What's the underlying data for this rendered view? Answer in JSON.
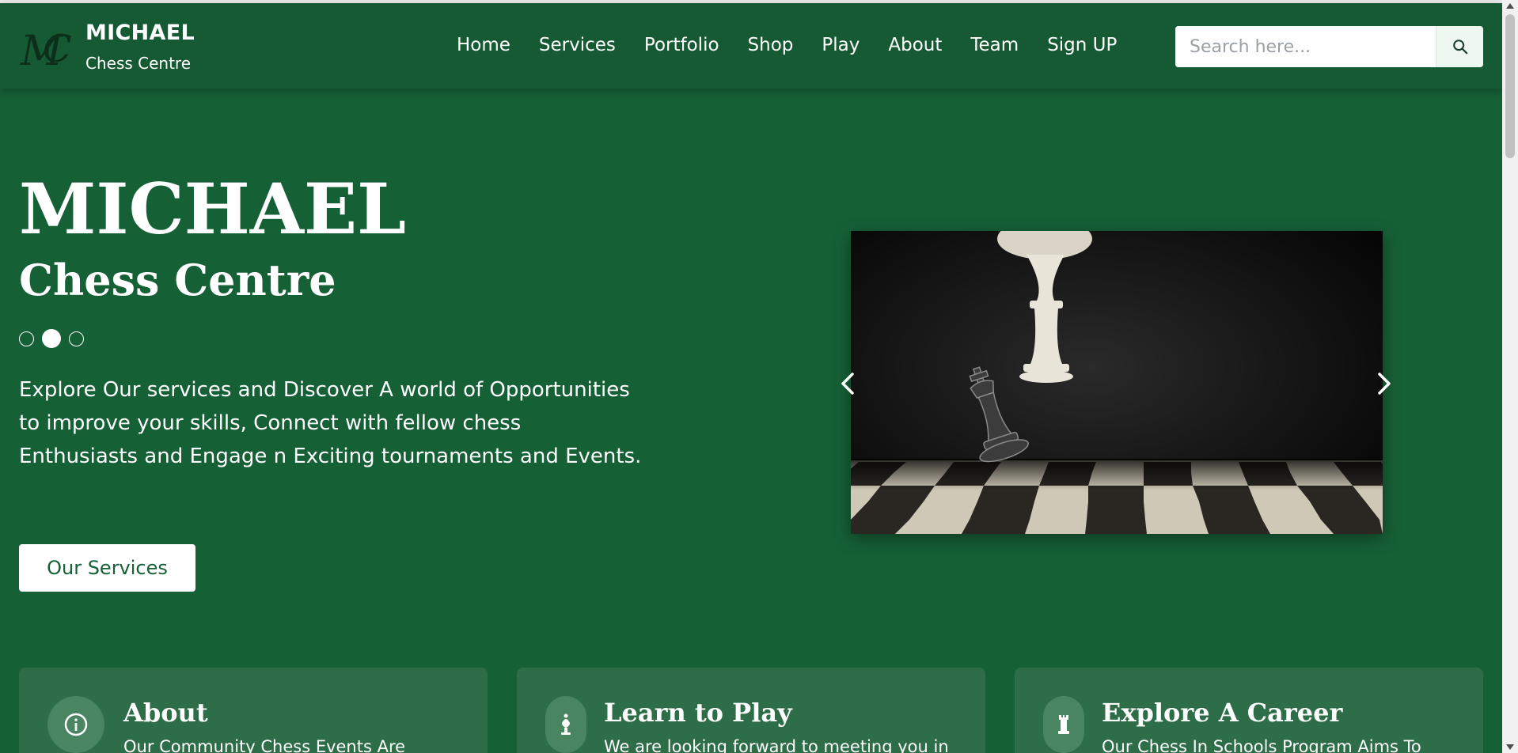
{
  "header": {
    "brand_name": "MICHAEL",
    "brand_sub": "Chess Centre",
    "logo_text": "MC",
    "nav": [
      {
        "label": "Home"
      },
      {
        "label": "Services"
      },
      {
        "label": "Portfolio"
      },
      {
        "label": "Shop"
      },
      {
        "label": "Play"
      },
      {
        "label": "About"
      },
      {
        "label": "Team"
      },
      {
        "label": "Sign UP"
      }
    ],
    "search_placeholder": "Search here..."
  },
  "hero": {
    "title": "MICHAEL",
    "subtitle": "Chess Centre",
    "slides_count": 3,
    "active_slide": 2,
    "description": "Explore Our services and Discover A world of Opportunities to improve your skills, Connect with fellow chess Enthusiasts and Engage n Exciting tournaments and Events.",
    "button_label": "Our Services"
  },
  "cards": [
    {
      "title": "About",
      "text": "Our Community Chess Events Are",
      "icon": "info-icon"
    },
    {
      "title": "Learn to Play",
      "text": "We are looking forward to meeting you in",
      "icon": "bishop-icon"
    },
    {
      "title": "Explore A Career",
      "text": "Our Chess In Schools Program Aims To",
      "icon": "rook-icon"
    }
  ],
  "colors": {
    "background": "#166036",
    "header": "#155a33",
    "card": "#2d6d48",
    "button_text": "#166036"
  }
}
